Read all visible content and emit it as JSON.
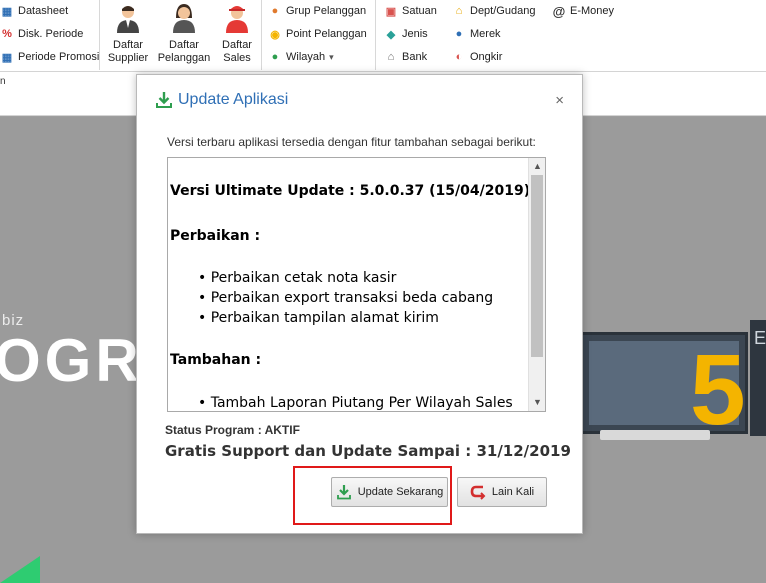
{
  "ribbon": {
    "group1": [
      "Datasheet",
      "Disk. Periode",
      "Periode Promosi"
    ],
    "big_buttons": [
      {
        "line1": "Daftar",
        "line2": "Supplier"
      },
      {
        "line1": "Daftar",
        "line2": "Pelanggan"
      },
      {
        "line1": "Daftar",
        "line2": "Sales"
      }
    ],
    "group3": [
      "Grup Pelanggan",
      "Point Pelanggan",
      "Wilayah"
    ],
    "group4": [
      "Satuan",
      "Jenis",
      "Bank"
    ],
    "group5": [
      "Dept/Gudang",
      "Merek",
      "Ongkir"
    ],
    "group6": [
      "E-Money"
    ],
    "wilayah_dropdown": "▾",
    "subbar_text": "n"
  },
  "background": {
    "biz": "biz",
    "ogr": "OGR",
    "big_number": "5",
    "panel_letter": "E"
  },
  "dialog": {
    "title": "Update Aplikasi",
    "close": "×",
    "intro": "Versi terbaru aplikasi tersedia dengan fitur tambahan sebagai berikut:",
    "version_line": "Versi Ultimate Update : 5.0.0.37  (15/04/2019)",
    "sections": {
      "fixes_title": "Perbaikan :",
      "fixes": [
        "• Perbaikan cetak nota kasir",
        "• Perbaikan export transaksi beda cabang",
        "• Perbaikan tampilan alamat kirim"
      ],
      "additions_title": "Tambahan :",
      "additions": [
        "• Tambah Laporan Piutang Per Wilayah Sales"
      ]
    },
    "status_program": "Status Program : AKTIF",
    "support": "Gratis Support dan Update Sampai : 31/12/2019",
    "update_button": "Update Sekarang",
    "later_button": "Lain Kali"
  },
  "colors": {
    "title_blue": "#2f6fb5",
    "highlight_red": "#e01919",
    "accent_yellow": "#f4b400"
  }
}
